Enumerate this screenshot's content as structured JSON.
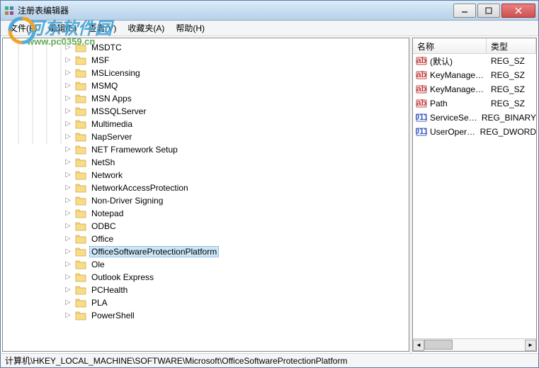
{
  "window": {
    "title": "注册表编辑器"
  },
  "menu": {
    "file": "文件(F)",
    "edit": "编辑(E)",
    "view": "查看(V)",
    "favorites": "收藏夹(A)",
    "help": "帮助(H)"
  },
  "tree": {
    "items": [
      {
        "label": "MSDTC"
      },
      {
        "label": "MSF"
      },
      {
        "label": "MSLicensing"
      },
      {
        "label": "MSMQ"
      },
      {
        "label": "MSN Apps"
      },
      {
        "label": "MSSQLServer"
      },
      {
        "label": "Multimedia"
      },
      {
        "label": "NapServer"
      },
      {
        "label": "NET Framework Setup"
      },
      {
        "label": "NetSh"
      },
      {
        "label": "Network"
      },
      {
        "label": "NetworkAccessProtection"
      },
      {
        "label": "Non-Driver Signing"
      },
      {
        "label": "Notepad"
      },
      {
        "label": "ODBC"
      },
      {
        "label": "Office"
      },
      {
        "label": "OfficeSoftwareProtectionPlatform",
        "selected": true
      },
      {
        "label": "Ole"
      },
      {
        "label": "Outlook Express"
      },
      {
        "label": "PCHealth"
      },
      {
        "label": "PLA"
      },
      {
        "label": "PowerShell"
      }
    ]
  },
  "list": {
    "columns": {
      "name": "名称",
      "type": "类型"
    },
    "rows": [
      {
        "icon": "string",
        "name": "(默认)",
        "type": "REG_SZ"
      },
      {
        "icon": "string",
        "name": "KeyManageme...",
        "type": "REG_SZ"
      },
      {
        "icon": "string",
        "name": "KeyManageme...",
        "type": "REG_SZ"
      },
      {
        "icon": "string",
        "name": "Path",
        "type": "REG_SZ"
      },
      {
        "icon": "binary",
        "name": "ServiceSession...",
        "type": "REG_BINARY"
      },
      {
        "icon": "binary",
        "name": "UserOperations",
        "type": "REG_DWORD"
      }
    ]
  },
  "statusbar": {
    "path": "计算机\\HKEY_LOCAL_MACHINE\\SOFTWARE\\Microsoft\\OfficeSoftwareProtectionPlatform"
  },
  "watermark": {
    "text": "河东软件园",
    "url": "www.pc0359.cn"
  }
}
